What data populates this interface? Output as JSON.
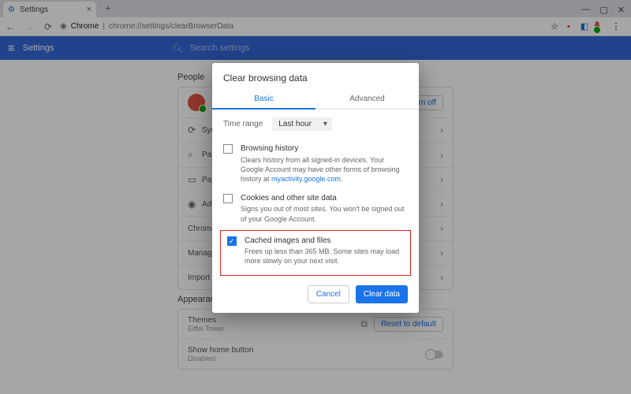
{
  "window": {
    "tab_title": "Settings",
    "min": "—",
    "max": "▢",
    "close": "✕",
    "plus": "+"
  },
  "addr": {
    "chrome_label": "Chrome",
    "url": "chrome://settings/clearBrowserData",
    "star": "☆",
    "menu": "⋮"
  },
  "header": {
    "title": "Settings",
    "search_ph": "Search settings"
  },
  "people": {
    "title": "People",
    "turn_off": "Turn off",
    "rows": [
      "Sync",
      "Passwords",
      "Payment methods",
      "Addresses and more",
      "Chrome name and picture",
      "Manage other people",
      "Import bookmarks and settings"
    ]
  },
  "appearance": {
    "title": "Appearance",
    "themes": "Themes",
    "theme_sub": "Eiffel Tower",
    "reset": "Reset to default",
    "home": "Show home button",
    "home_sub": "Disabled"
  },
  "dialog": {
    "title": "Clear browsing data",
    "tab_basic": "Basic",
    "tab_adv": "Advanced",
    "time_label": "Time range",
    "time_value": "Last hour",
    "opt1_t": "Browsing history",
    "opt1_d1": "Clears history from all signed-in devices. Your Google Account may have other forms of browsing history at ",
    "opt1_link": "myactivity.google.com",
    "opt2_t": "Cookies and other site data",
    "opt2_d": "Signs you out of most sites. You won't be signed out of your Google Account.",
    "opt3_t": "Cached images and files",
    "opt3_d": "Frees up less than 365 MB. Some sites may load more slowly on your next visit.",
    "cancel": "Cancel",
    "clear": "Clear data"
  }
}
